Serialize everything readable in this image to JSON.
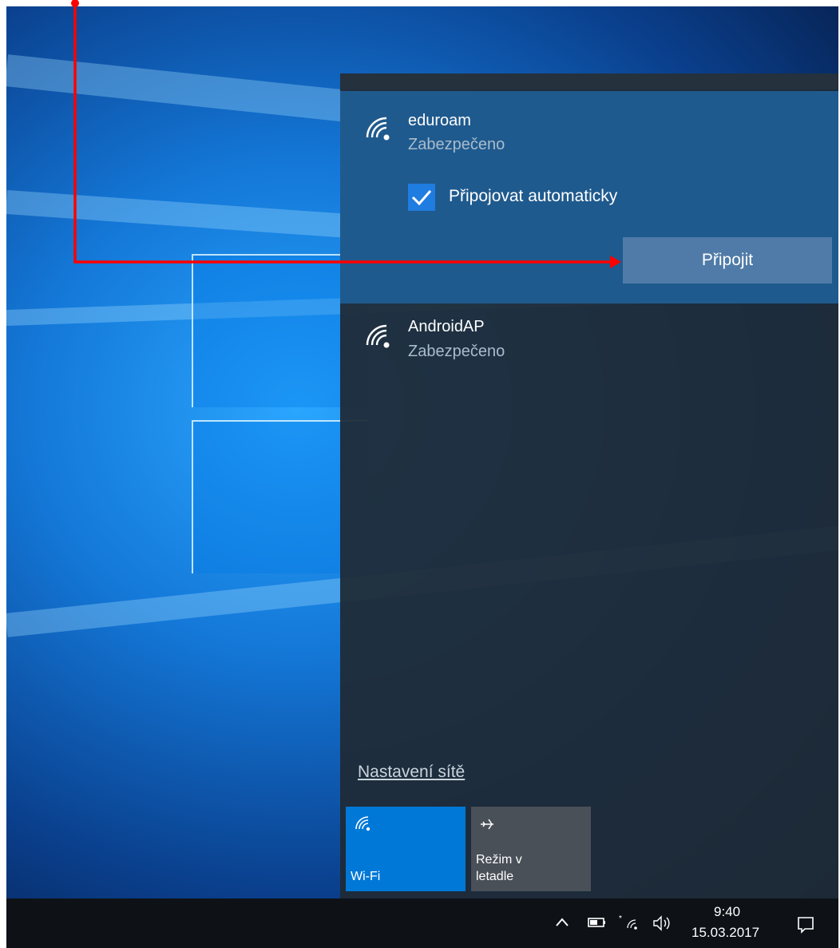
{
  "networks": [
    {
      "ssid": "eduroam",
      "security": "Zabezpečeno",
      "selected": true
    },
    {
      "ssid": "AndroidAP",
      "security": "Zabezpečeno",
      "selected": false
    }
  ],
  "connect_panel": {
    "auto_connect_label": "Připojovat automaticky",
    "auto_connect_checked": true,
    "connect_button": "Připojit"
  },
  "settings_link": "Nastavení sítě",
  "quick_actions": [
    {
      "label": "Wi-Fi",
      "icon": "wifi-icon",
      "active": true
    },
    {
      "label": "Režim v letadle",
      "label_line1": "Režim v",
      "label_line2": "letadle",
      "icon": "airplane-icon",
      "active": false
    }
  ],
  "taskbar": {
    "time": "9:40",
    "date": "15.03.2017",
    "tray_icons": [
      "chevron-up-icon",
      "battery-icon",
      "wifi-icon",
      "volume-icon",
      "notification-icon"
    ]
  },
  "colors": {
    "annotation": "#ff0000",
    "accent": "#0078d7",
    "selected_network_bg": "#1f5a8e",
    "flyout_bg": "#1f2a36",
    "taskbar_bg": "#0e1217"
  }
}
